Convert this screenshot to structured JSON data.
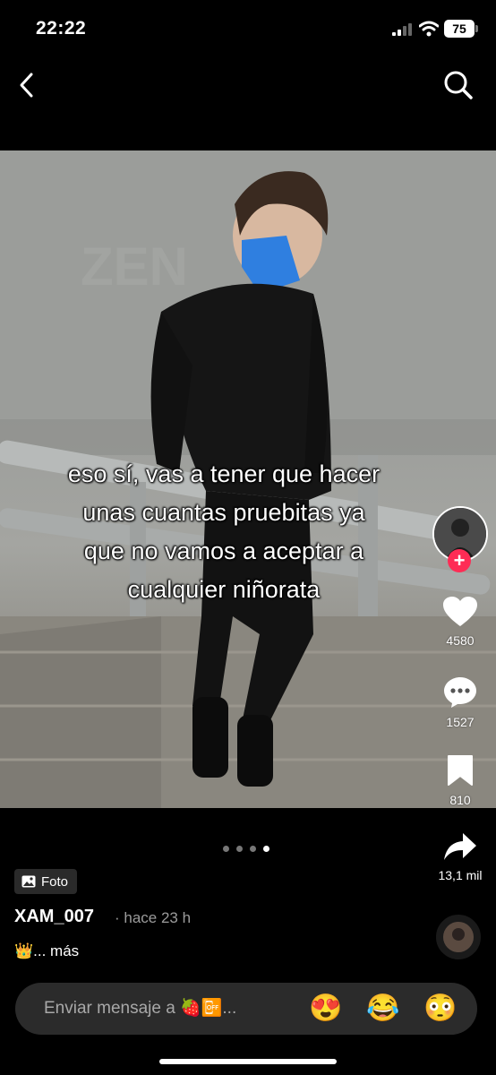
{
  "status_bar": {
    "time": "22:22",
    "battery": "75"
  },
  "post": {
    "caption_lines": [
      "eso sí, vas a tener que hacer",
      "unas cuantas pruebitas ya",
      "que no vamos a aceptar a",
      "cualquier niñorata"
    ],
    "carousel": {
      "total": 4,
      "active": 4
    }
  },
  "actions": {
    "likes": "4580",
    "comments": "1527",
    "saves": "810",
    "shares": "13,1 mil"
  },
  "meta": {
    "type_badge": "Foto",
    "username": "XAM_007",
    "time_ago": "· hace 23 h",
    "description": "👑... más"
  },
  "message_bar": {
    "placeholder": "Enviar mensaje a 🍓📴...",
    "quick_emojis": [
      "😍",
      "😂",
      "😳"
    ]
  },
  "colors": {
    "accent": "#fe2c55",
    "background": "#000000"
  }
}
